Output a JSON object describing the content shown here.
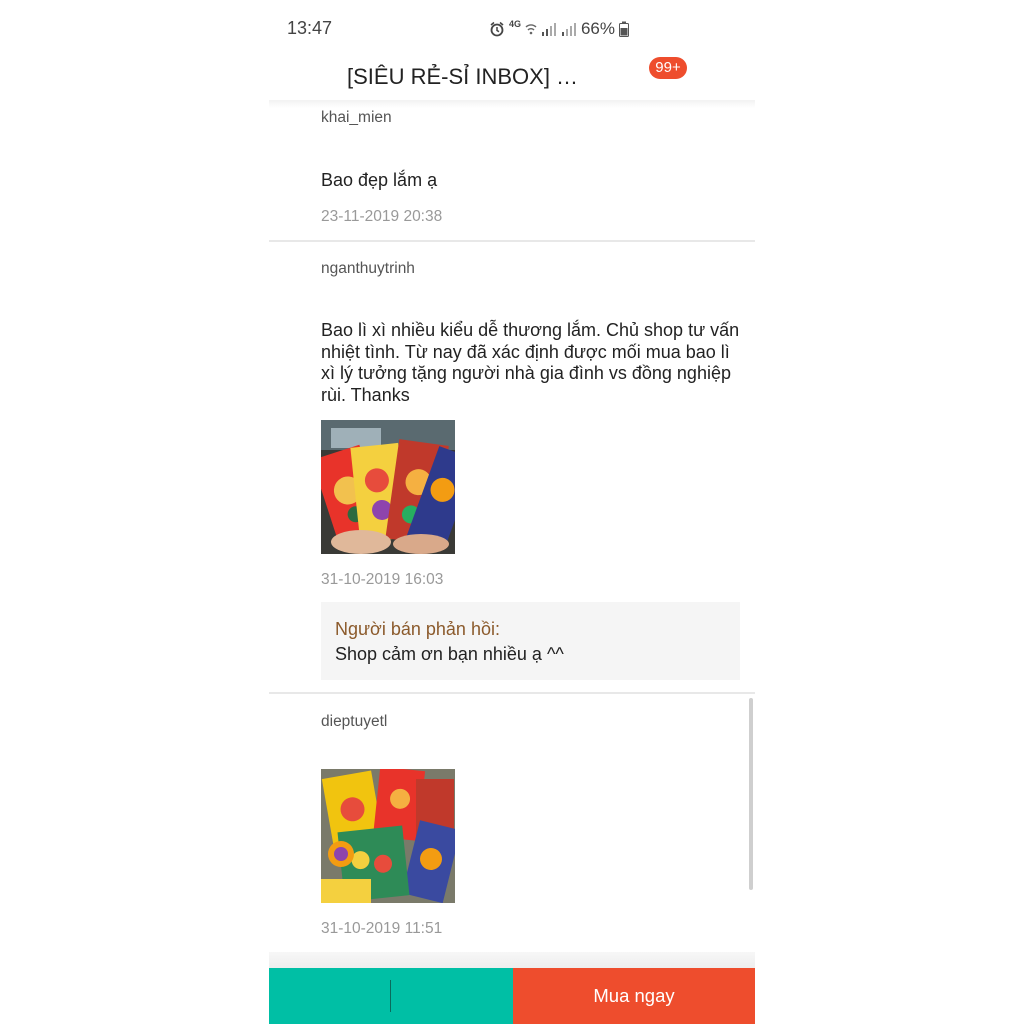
{
  "status_bar": {
    "time": "13:47",
    "network_label": "4G",
    "battery": "66%",
    "icons": [
      "alarm-icon",
      "wifi-icon",
      "signal-icon",
      "signal-icon",
      "battery-icon"
    ]
  },
  "header": {
    "title": "[SIÊU RẺ-SỈ INBOX] 0...",
    "badge": "99+"
  },
  "reviews": [
    {
      "username": "khai_mien",
      "comment": "Bao đẹp lắm ạ",
      "date": "23-11-2019 20:38"
    },
    {
      "username": "nganthuytrinh",
      "comment": "Bao lì xì nhiều kiểu dễ thương lắm. Chủ shop tư vấn nhiệt tình. Từ nay đã xác định được mối mua bao lì xì lý tưởng tặng người nhà gia đình vs đồng nghiệp rùi. Thanks",
      "date": "31-10-2019 16:03",
      "seller_reply": {
        "label": "Người bán phản hồi:",
        "text": "Shop cảm ơn bạn nhiều ạ ^^"
      }
    },
    {
      "username": "dieptuyetl",
      "date": "31-10-2019 11:51"
    }
  ],
  "bottom_bar": {
    "buy_label": "Mua ngay"
  },
  "colors": {
    "accent": "#ee4d2d",
    "chat": "#00bfa5",
    "reply_label": "#8b5a2b",
    "muted": "#999999"
  }
}
